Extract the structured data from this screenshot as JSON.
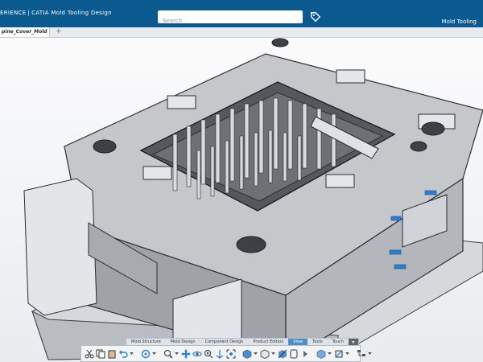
{
  "header": {
    "brand_left": "ERIENCE",
    "brand_app": "CATIA",
    "brand_sub": "Mold Tooling Design",
    "search_placeholder": "Search",
    "app_title": "Mold Tooling",
    "tag_icon": "tag-icon"
  },
  "document_tab": {
    "label": "pine_Cover_Mold",
    "add_icon": "+"
  },
  "action_bar": {
    "sections": [
      "Mold Structure",
      "Mold Design",
      "Component Design",
      "Product Edition",
      "View",
      "Tools",
      "Touch"
    ],
    "active_section": "View",
    "tools": [
      "cut-icon",
      "copy-icon",
      "paste-icon",
      "undo-icon",
      "update-icon",
      "zoom-area-icon",
      "pan-icon",
      "rotate-icon",
      "zoom-icon",
      "normal-view-icon",
      "fit-all-icon",
      "view-mode-icon",
      "iso-view-icon",
      "hide-show-icon",
      "swap-icon",
      "play-icon",
      "render-icon",
      "section-icon",
      "tree-icon"
    ]
  },
  "colors": {
    "header_bg": "#0a5a8f",
    "active_tab": "#4d8fc6",
    "accent_blue": "#2a7fd4"
  }
}
